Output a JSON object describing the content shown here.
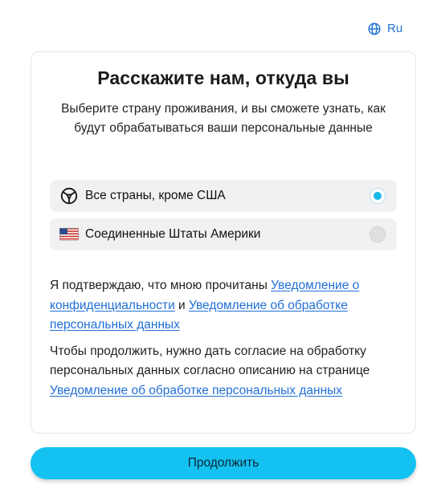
{
  "header": {
    "language_label": "Ru",
    "language_icon": "globe-icon"
  },
  "card": {
    "title": "Расскажите нам, откуда вы",
    "subtitle": "Выберите страну проживания, и вы сможете узнать, как будут обрабатываться ваши персональные данные"
  },
  "options": [
    {
      "label": "Все страны, кроме США",
      "icon": "globe-grid-icon",
      "selected": true
    },
    {
      "label": "Соединенные Штаты Америки",
      "icon": "us-flag-icon",
      "selected": false
    }
  ],
  "consent": {
    "p1_prefix": "Я подтверждаю, что мною прочитаны ",
    "p1_link1": "Уведомление о конфиденциальности",
    "p1_and": " и ",
    "p1_link2": "Уведомление об обработке персональных данных",
    "p2_prefix": "Чтобы продолжить, нужно дать согласие на обработку персональных данных согласно описанию на странице ",
    "p2_link": "Уведомление об обработке персональных данных"
  },
  "footer": {
    "continue_label": "Продолжить"
  },
  "colors": {
    "accent": "#14c2f2",
    "link": "#1f6fd6",
    "radio_selected": "#17b7ea"
  }
}
